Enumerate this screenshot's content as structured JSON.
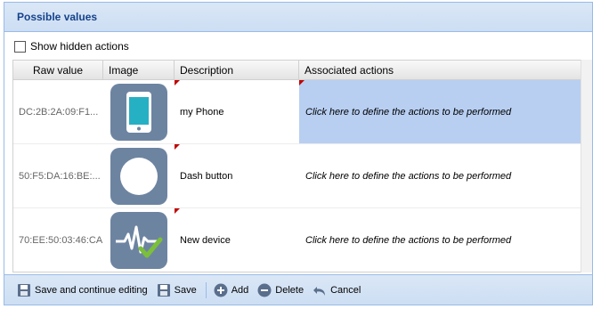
{
  "panel": {
    "title": "Possible values"
  },
  "options": {
    "show_hidden_label": "Show hidden actions"
  },
  "grid": {
    "columns": [
      "Raw value",
      "Image",
      "Description",
      "Associated actions"
    ],
    "rows": [
      {
        "raw": "DC:2B:2A:09:F1...",
        "image": "phone-icon",
        "description": "my Phone",
        "actions": "Click here to define the actions to be performed",
        "selected": true
      },
      {
        "raw": "50:F5:DA:16:BE:...",
        "image": "circle-button-icon",
        "description": "Dash button",
        "actions": "Click here to define the actions to be performed",
        "selected": false
      },
      {
        "raw": "70:EE:50:03:46:CA",
        "image": "activity-check-icon",
        "description": "New device",
        "actions": "Click here to define the actions to be performed",
        "selected": false
      }
    ]
  },
  "toolbar": {
    "save_continue": "Save and continue editing",
    "save": "Save",
    "add": "Add",
    "delete": "Delete",
    "cancel": "Cancel"
  },
  "colors": {
    "header_text": "#15428b",
    "tile": "#6d84a1",
    "selection": "#b8cff2",
    "phone_screen": "#26b0c4",
    "check": "#7bbf3a"
  }
}
